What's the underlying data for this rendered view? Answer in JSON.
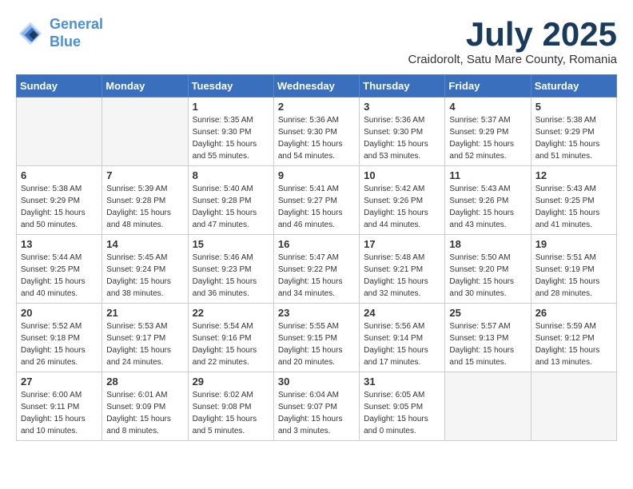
{
  "logo": {
    "line1": "General",
    "line2": "Blue"
  },
  "header": {
    "month": "July 2025",
    "location": "Craidorolt, Satu Mare County, Romania"
  },
  "weekdays": [
    "Sunday",
    "Monday",
    "Tuesday",
    "Wednesday",
    "Thursday",
    "Friday",
    "Saturday"
  ],
  "weeks": [
    [
      {
        "day": "",
        "info": ""
      },
      {
        "day": "",
        "info": ""
      },
      {
        "day": "1",
        "info": "Sunrise: 5:35 AM\nSunset: 9:30 PM\nDaylight: 15 hours\nand 55 minutes."
      },
      {
        "day": "2",
        "info": "Sunrise: 5:36 AM\nSunset: 9:30 PM\nDaylight: 15 hours\nand 54 minutes."
      },
      {
        "day": "3",
        "info": "Sunrise: 5:36 AM\nSunset: 9:30 PM\nDaylight: 15 hours\nand 53 minutes."
      },
      {
        "day": "4",
        "info": "Sunrise: 5:37 AM\nSunset: 9:29 PM\nDaylight: 15 hours\nand 52 minutes."
      },
      {
        "day": "5",
        "info": "Sunrise: 5:38 AM\nSunset: 9:29 PM\nDaylight: 15 hours\nand 51 minutes."
      }
    ],
    [
      {
        "day": "6",
        "info": "Sunrise: 5:38 AM\nSunset: 9:29 PM\nDaylight: 15 hours\nand 50 minutes."
      },
      {
        "day": "7",
        "info": "Sunrise: 5:39 AM\nSunset: 9:28 PM\nDaylight: 15 hours\nand 48 minutes."
      },
      {
        "day": "8",
        "info": "Sunrise: 5:40 AM\nSunset: 9:28 PM\nDaylight: 15 hours\nand 47 minutes."
      },
      {
        "day": "9",
        "info": "Sunrise: 5:41 AM\nSunset: 9:27 PM\nDaylight: 15 hours\nand 46 minutes."
      },
      {
        "day": "10",
        "info": "Sunrise: 5:42 AM\nSunset: 9:26 PM\nDaylight: 15 hours\nand 44 minutes."
      },
      {
        "day": "11",
        "info": "Sunrise: 5:43 AM\nSunset: 9:26 PM\nDaylight: 15 hours\nand 43 minutes."
      },
      {
        "day": "12",
        "info": "Sunrise: 5:43 AM\nSunset: 9:25 PM\nDaylight: 15 hours\nand 41 minutes."
      }
    ],
    [
      {
        "day": "13",
        "info": "Sunrise: 5:44 AM\nSunset: 9:25 PM\nDaylight: 15 hours\nand 40 minutes."
      },
      {
        "day": "14",
        "info": "Sunrise: 5:45 AM\nSunset: 9:24 PM\nDaylight: 15 hours\nand 38 minutes."
      },
      {
        "day": "15",
        "info": "Sunrise: 5:46 AM\nSunset: 9:23 PM\nDaylight: 15 hours\nand 36 minutes."
      },
      {
        "day": "16",
        "info": "Sunrise: 5:47 AM\nSunset: 9:22 PM\nDaylight: 15 hours\nand 34 minutes."
      },
      {
        "day": "17",
        "info": "Sunrise: 5:48 AM\nSunset: 9:21 PM\nDaylight: 15 hours\nand 32 minutes."
      },
      {
        "day": "18",
        "info": "Sunrise: 5:50 AM\nSunset: 9:20 PM\nDaylight: 15 hours\nand 30 minutes."
      },
      {
        "day": "19",
        "info": "Sunrise: 5:51 AM\nSunset: 9:19 PM\nDaylight: 15 hours\nand 28 minutes."
      }
    ],
    [
      {
        "day": "20",
        "info": "Sunrise: 5:52 AM\nSunset: 9:18 PM\nDaylight: 15 hours\nand 26 minutes."
      },
      {
        "day": "21",
        "info": "Sunrise: 5:53 AM\nSunset: 9:17 PM\nDaylight: 15 hours\nand 24 minutes."
      },
      {
        "day": "22",
        "info": "Sunrise: 5:54 AM\nSunset: 9:16 PM\nDaylight: 15 hours\nand 22 minutes."
      },
      {
        "day": "23",
        "info": "Sunrise: 5:55 AM\nSunset: 9:15 PM\nDaylight: 15 hours\nand 20 minutes."
      },
      {
        "day": "24",
        "info": "Sunrise: 5:56 AM\nSunset: 9:14 PM\nDaylight: 15 hours\nand 17 minutes."
      },
      {
        "day": "25",
        "info": "Sunrise: 5:57 AM\nSunset: 9:13 PM\nDaylight: 15 hours\nand 15 minutes."
      },
      {
        "day": "26",
        "info": "Sunrise: 5:59 AM\nSunset: 9:12 PM\nDaylight: 15 hours\nand 13 minutes."
      }
    ],
    [
      {
        "day": "27",
        "info": "Sunrise: 6:00 AM\nSunset: 9:11 PM\nDaylight: 15 hours\nand 10 minutes."
      },
      {
        "day": "28",
        "info": "Sunrise: 6:01 AM\nSunset: 9:09 PM\nDaylight: 15 hours\nand 8 minutes."
      },
      {
        "day": "29",
        "info": "Sunrise: 6:02 AM\nSunset: 9:08 PM\nDaylight: 15 hours\nand 5 minutes."
      },
      {
        "day": "30",
        "info": "Sunrise: 6:04 AM\nSunset: 9:07 PM\nDaylight: 15 hours\nand 3 minutes."
      },
      {
        "day": "31",
        "info": "Sunrise: 6:05 AM\nSunset: 9:05 PM\nDaylight: 15 hours\nand 0 minutes."
      },
      {
        "day": "",
        "info": ""
      },
      {
        "day": "",
        "info": ""
      }
    ]
  ]
}
